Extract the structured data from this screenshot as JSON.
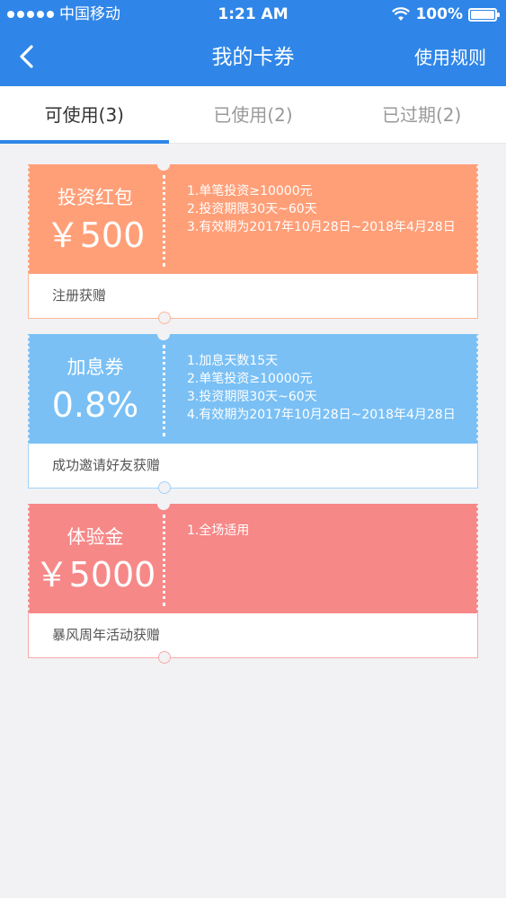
{
  "status_bar": {
    "carrier": "中国移动",
    "time": "1:21 AM",
    "battery": "100%"
  },
  "nav": {
    "title": "我的卡券",
    "rules_label": "使用规则",
    "back_icon": "chevron-left-icon"
  },
  "tabs": [
    {
      "label": "可使用(3)",
      "active": true
    },
    {
      "label": "已使用(2)",
      "active": false
    },
    {
      "label": "已过期(2)",
      "active": false
    }
  ],
  "colors": {
    "brand": "#2f86e8",
    "orange": "#ff9f78",
    "blue": "#7ac0f5",
    "red": "#f78888"
  },
  "coupons": [
    {
      "name": "投资红包",
      "value": "￥500",
      "rules": [
        "1.单笔投资≥10000元",
        "2.投资期限30天~60天",
        "3.有效期为2017年10月28日~2018年4月28日"
      ],
      "source": "注册获赠"
    },
    {
      "name": "加息券",
      "value": "0.8%",
      "rules": [
        "1.加息天数15天",
        "2.单笔投资≥10000元",
        "3.投资期限30天~60天",
        "4.有效期为2017年10月28日~2018年4月28日"
      ],
      "source": "成功邀请好友获赠"
    },
    {
      "name": "体验金",
      "value": "￥5000",
      "rules": [
        "1.全场适用"
      ],
      "source": "暴风周年活动获赠"
    }
  ]
}
